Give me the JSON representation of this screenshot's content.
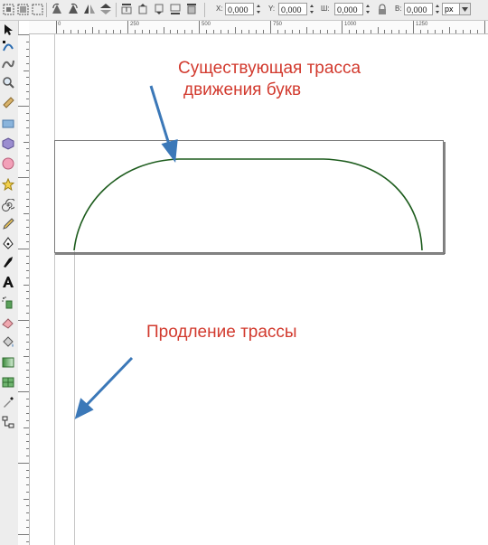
{
  "controls": {
    "x_label": "X:",
    "x_value": "0,000",
    "y_label": "Y:",
    "y_value": "0,000",
    "w_label": "Ш:",
    "w_value": "0,000",
    "h_label": "В:",
    "h_value": "0,000",
    "unit": "px"
  },
  "ruler": {
    "labels": [
      "0",
      "250",
      "500",
      "750",
      "1000",
      "1250"
    ]
  },
  "tools": [
    "selector-tool",
    "node-tool",
    "tweak-tool",
    "zoom-tool",
    "measure-tool",
    "rectangle-tool",
    "3d-box-tool",
    "ellipse-tool",
    "star-tool",
    "spiral-tool",
    "pencil-tool",
    "pen-tool",
    "calligraphy-tool",
    "text-tool",
    "spray-tool",
    "eraser-tool",
    "paint-bucket-tool",
    "gradient-tool",
    "mesh-tool",
    "dropper-tool",
    "connector-tool"
  ],
  "annotations": {
    "existing_path_line1": "Существующая трасса",
    "existing_path_line2": "движения букв",
    "extension": "Продление трассы"
  },
  "colors": {
    "annotation_text": "#d23a2e",
    "arrow": "#3b78b8",
    "path": "#1d5c1d"
  }
}
